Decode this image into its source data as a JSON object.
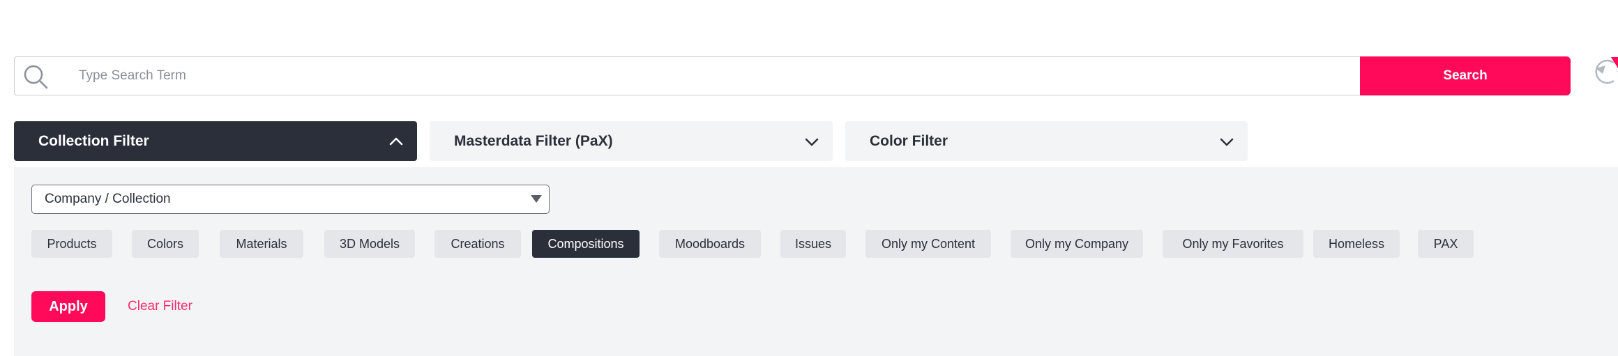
{
  "search": {
    "placeholder": "Type Search Term",
    "button_label": "Search"
  },
  "filter_tabs": [
    {
      "label": "Collection Filter",
      "state": "expanded"
    },
    {
      "label": "Masterdata Filter (PaX)",
      "state": "collapsed"
    },
    {
      "label": "Color Filter",
      "state": "collapsed"
    }
  ],
  "panel": {
    "company_select_value": "Company / Collection",
    "chips": [
      {
        "label": "Products",
        "selected": false
      },
      {
        "label": "Colors",
        "selected": false
      },
      {
        "label": "Materials",
        "selected": false
      },
      {
        "label": "3D Models",
        "selected": false
      },
      {
        "label": "Creations",
        "selected": false
      },
      {
        "label": "Compositions",
        "selected": true
      },
      {
        "label": "Moodboards",
        "selected": false
      },
      {
        "label": "Issues",
        "selected": false
      },
      {
        "label": "Only my Content",
        "selected": false
      },
      {
        "label": "Only my Company",
        "selected": false
      },
      {
        "label": "Only my Favorites",
        "selected": false
      },
      {
        "label": "Homeless",
        "selected": false
      },
      {
        "label": "PAX",
        "selected": false
      }
    ],
    "apply_label": "Apply",
    "clear_label": "Clear Filter"
  },
  "colors": {
    "accent": "#ff0a5a",
    "dark": "#2b2f3a",
    "panel_bg": "#f3f4f6",
    "chip_bg": "#e4e6ea"
  },
  "icons": [
    "search-icon",
    "chevron-up-icon",
    "chevron-down-icon",
    "reset-icon",
    "dropdown-arrow-icon"
  ]
}
